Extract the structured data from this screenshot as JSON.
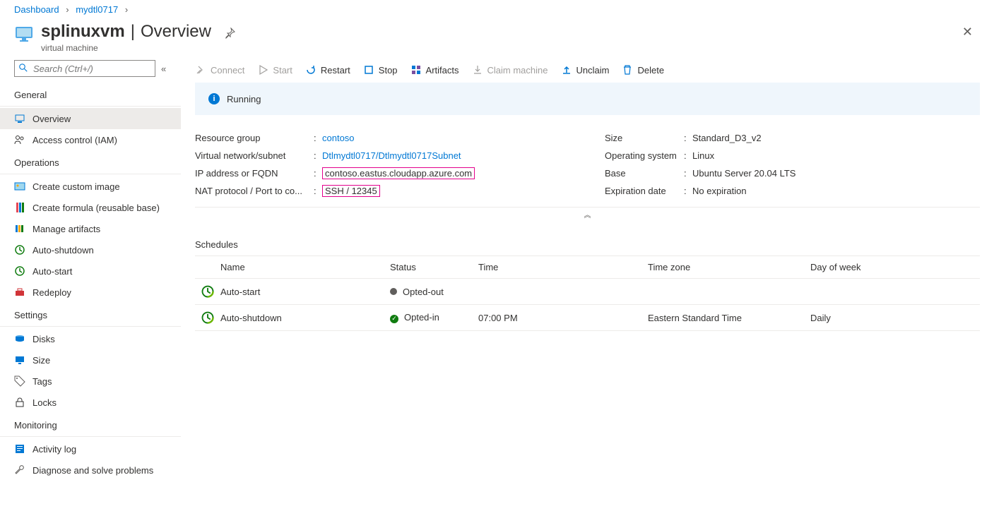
{
  "breadcrumb": {
    "root": "Dashboard",
    "second": "mydtl0717"
  },
  "title": {
    "name": "splinuxvm",
    "section": "Overview",
    "subtitle": "virtual machine"
  },
  "search": {
    "placeholder": "Search (Ctrl+/)"
  },
  "nav": {
    "general": {
      "header": "General",
      "overview": "Overview",
      "iam": "Access control (IAM)"
    },
    "operations": {
      "header": "Operations",
      "custom_image": "Create custom image",
      "formula": "Create formula (reusable base)",
      "artifacts": "Manage artifacts",
      "auto_shutdown": "Auto-shutdown",
      "auto_start": "Auto-start",
      "redeploy": "Redeploy"
    },
    "settings": {
      "header": "Settings",
      "disks": "Disks",
      "size": "Size",
      "tags": "Tags",
      "locks": "Locks"
    },
    "monitoring": {
      "header": "Monitoring",
      "activity": "Activity log",
      "diagnose": "Diagnose and solve problems"
    }
  },
  "toolbar": {
    "connect": "Connect",
    "start": "Start",
    "restart": "Restart",
    "stop": "Stop",
    "artifacts": "Artifacts",
    "claim": "Claim machine",
    "unclaim": "Unclaim",
    "delete": "Delete"
  },
  "status": {
    "text": "Running"
  },
  "props": {
    "left": {
      "rg_label": "Resource group",
      "rg_val": "contoso",
      "vnet_label": "Virtual network/subnet",
      "vnet_val": "Dtlmydtl0717/Dtlmydtl0717Subnet",
      "ip_label": "IP address or FQDN",
      "ip_val": "contoso.eastus.cloudapp.azure.com",
      "nat_label": "NAT protocol / Port to co...",
      "nat_val": "SSH / 12345"
    },
    "right": {
      "size_label": "Size",
      "size_val": "Standard_D3_v2",
      "os_label": "Operating system",
      "os_val": "Linux",
      "base_label": "Base",
      "base_val": "Ubuntu Server 20.04 LTS",
      "exp_label": "Expiration date",
      "exp_val": "No expiration"
    }
  },
  "schedules": {
    "header": "Schedules",
    "cols": {
      "name": "Name",
      "status": "Status",
      "time": "Time",
      "tz": "Time zone",
      "dow": "Day of week"
    },
    "rows": [
      {
        "name": "Auto-start",
        "status": "Opted-out",
        "time": "",
        "tz": "",
        "dow": ""
      },
      {
        "name": "Auto-shutdown",
        "status": "Opted-in",
        "time": "07:00 PM",
        "tz": "Eastern Standard Time",
        "dow": "Daily"
      }
    ]
  }
}
